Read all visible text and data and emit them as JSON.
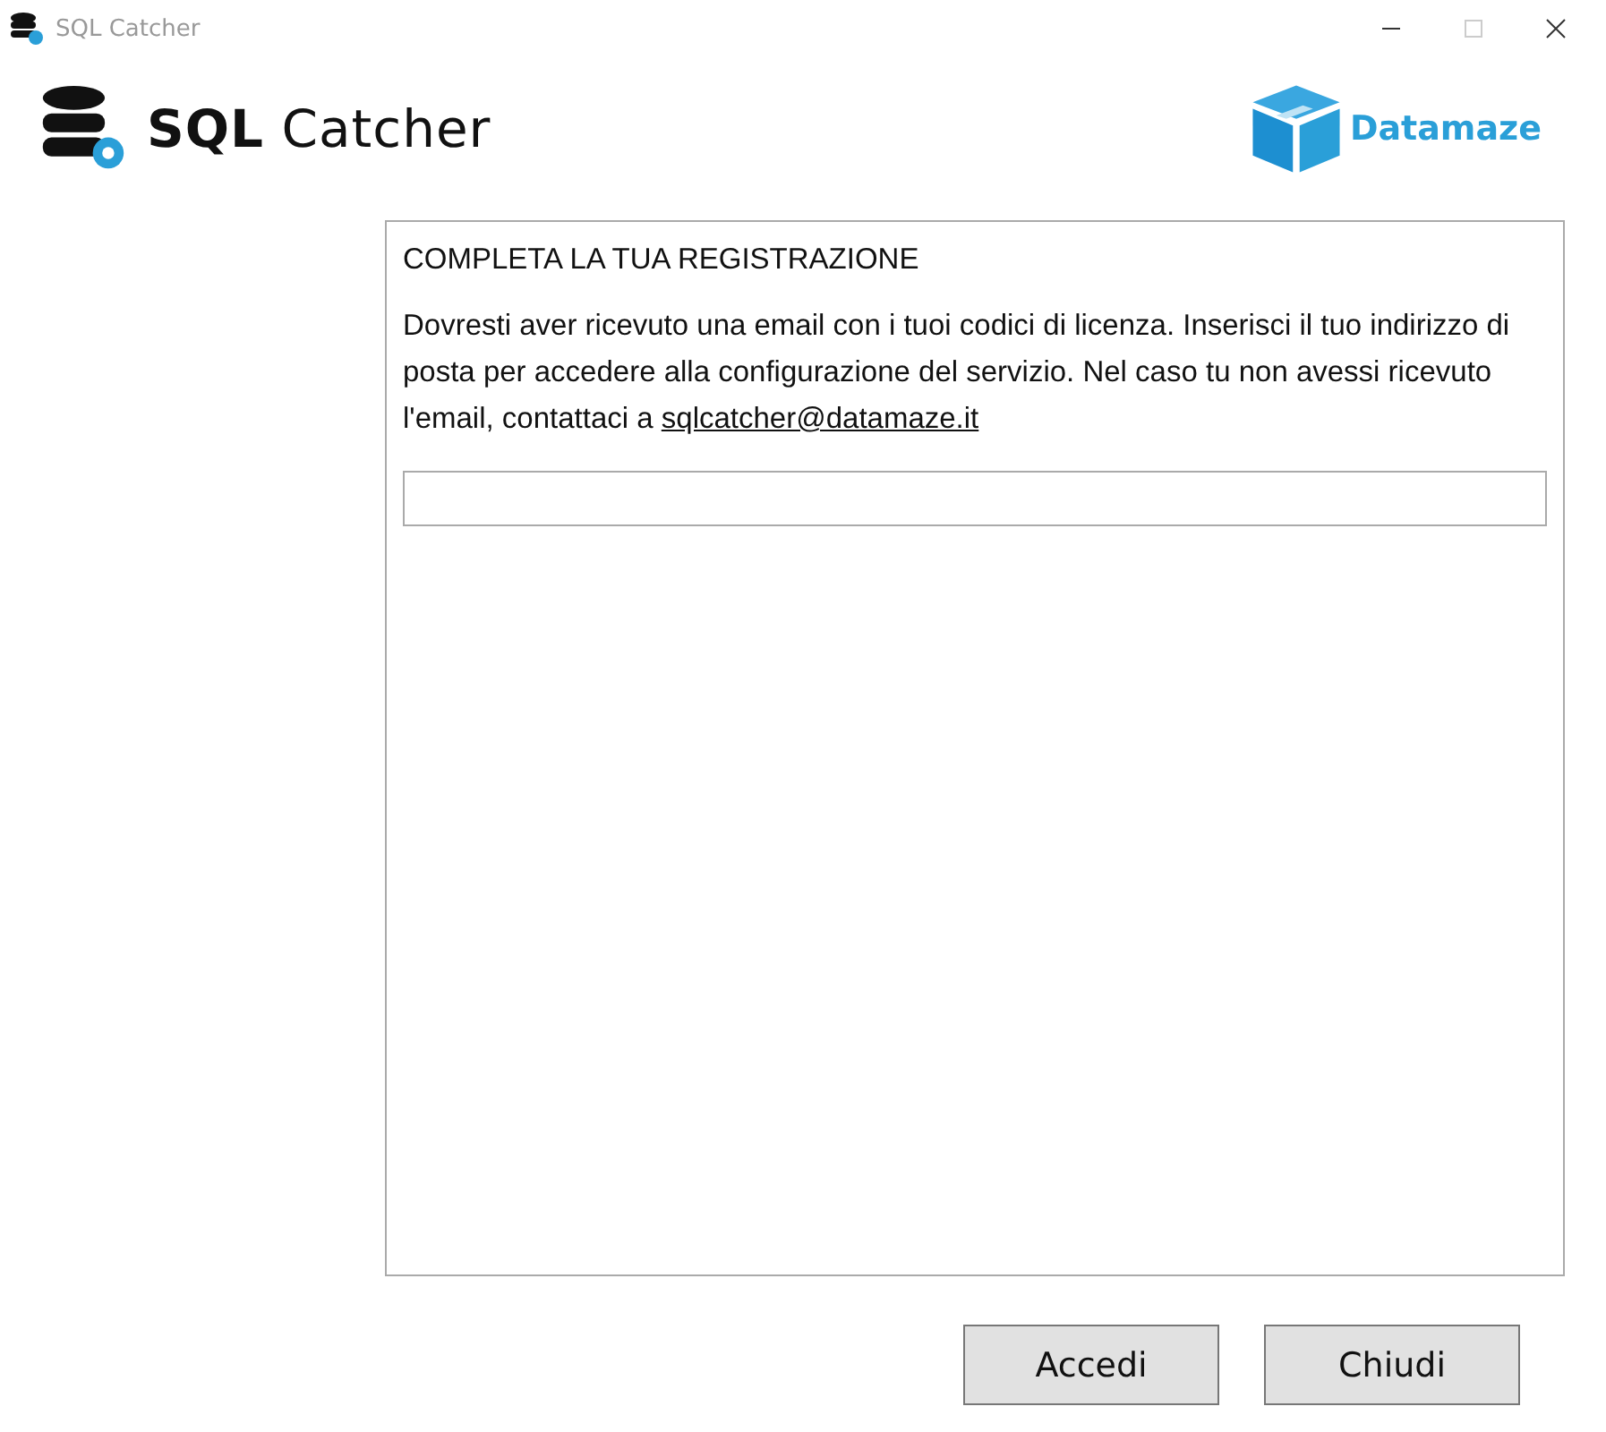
{
  "window": {
    "title": "SQL Catcher"
  },
  "header": {
    "app_logo": "**SQL** Catcher",
    "brand_logo": "Datamaze"
  },
  "panel": {
    "heading": "COMPLETA LA TUA REGISTRAZIONE",
    "message": "Dovresti aver ricevuto una email con i tuoi codici di licenza. Inserisci il tuo indirizzo di posta per accedere alla configurazione del servizio. Nel caso tu non avessi ricevuto l'email, contattaci a",
    "link": "sqlcatcher@datamaze.it"
  },
  "buttons": [
    "Accedi",
    "Chiudi"
  ]
}
